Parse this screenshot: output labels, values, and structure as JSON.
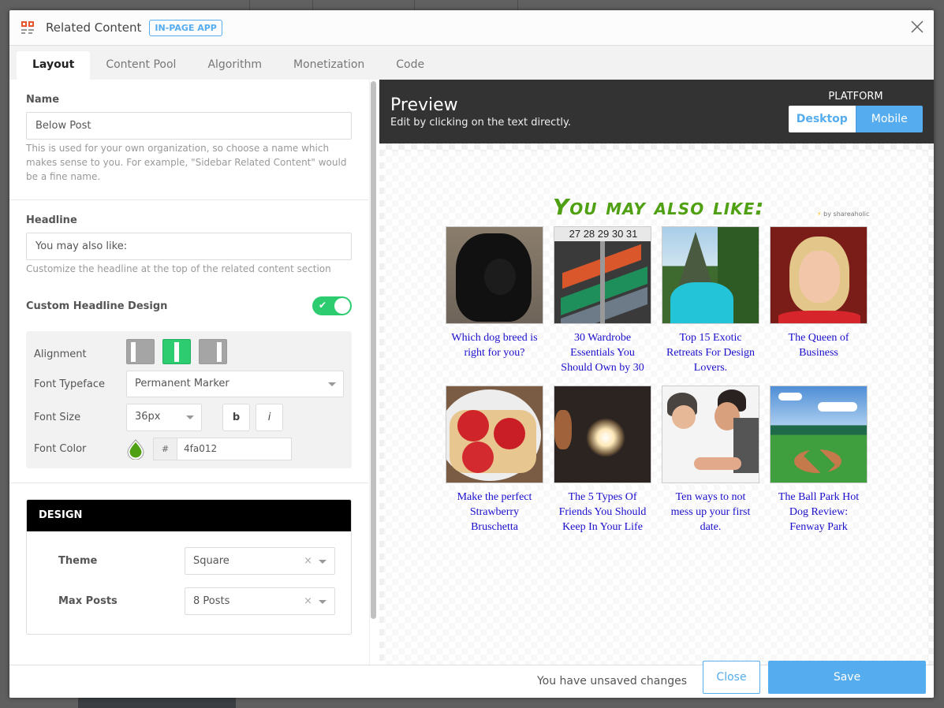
{
  "header": {
    "title": "Related Content",
    "badge": "IN-PAGE APP",
    "icon": "related-content-icon",
    "close_icon": "close-icon"
  },
  "tabs": [
    {
      "label": "Layout",
      "active": true
    },
    {
      "label": "Content Pool",
      "active": false
    },
    {
      "label": "Algorithm",
      "active": false
    },
    {
      "label": "Monetization",
      "active": false
    },
    {
      "label": "Code",
      "active": false
    }
  ],
  "form": {
    "name": {
      "label": "Name",
      "value": "Below Post",
      "help": "This is used for your own organization, so choose a name which makes sense to you. For example, \"Sidebar Related Content\" would be a fine name."
    },
    "headline": {
      "label": "Headline",
      "value": "You may also like:",
      "help": "Customize the headline at the top of the related content section"
    },
    "custom_headline_design": {
      "label": "Custom Headline Design",
      "enabled": true,
      "alignment_label": "Alignment",
      "alignment_options": [
        "left",
        "center",
        "right"
      ],
      "alignment_selected": "center",
      "typeface_label": "Font Typeface",
      "typeface_value": "Permanent Marker",
      "size_label": "Font Size",
      "size_value": "36px",
      "bold_label": "b",
      "italic_label": "i",
      "color_label": "Font Color",
      "color_hash": "#",
      "color_value": "4fa012",
      "color_hex": "#4fa012"
    },
    "design": {
      "title": "DESIGN",
      "theme_label": "Theme",
      "theme_value": "Square",
      "max_posts_label": "Max Posts",
      "max_posts_value": "8 Posts",
      "clear_glyph": "×"
    }
  },
  "preview": {
    "title": "Preview",
    "subtitle": "Edit by clicking on the text directly.",
    "platform_label": "PLATFORM",
    "platform_options": [
      "Desktop",
      "Mobile"
    ],
    "platform_selected": "Desktop",
    "headline": "You may also like:",
    "headline_color": "#4fa012",
    "byline": "by shareaholic",
    "byline_icon": "⚡",
    "posts": [
      {
        "title": "Which dog breed is right for you?",
        "image": "black-dog-on-wood-deck"
      },
      {
        "title": "30 Wardrobe Essentials You Should Own by 30",
        "image": "clothes-on-hangers-rack"
      },
      {
        "title": "Top 15 Exotic Retreats For Design Lovers.",
        "image": "tropical-pool-mountain"
      },
      {
        "title": "The Queen of Business",
        "image": "blonde-woman-portrait"
      },
      {
        "title": "Make the perfect Strawberry Bruschetta",
        "image": "strawberry-bruschetta"
      },
      {
        "title": "The 5 Types Of Friends You Should Keep In Your Life",
        "image": "sparkler-in-hands"
      },
      {
        "title": "Ten ways to not mess up your first date.",
        "image": "couple-face-to-face"
      },
      {
        "title": "The Ball Park Hot Dog Review: Fenway Park",
        "image": "fenway-park-stadium"
      }
    ]
  },
  "footer": {
    "status": "You have unsaved changes",
    "close_label": "Close",
    "save_label": "Save"
  },
  "colors": {
    "accent": "#55acee",
    "toggle_on": "#2ecc71",
    "brand_icon": "#e4572e"
  }
}
